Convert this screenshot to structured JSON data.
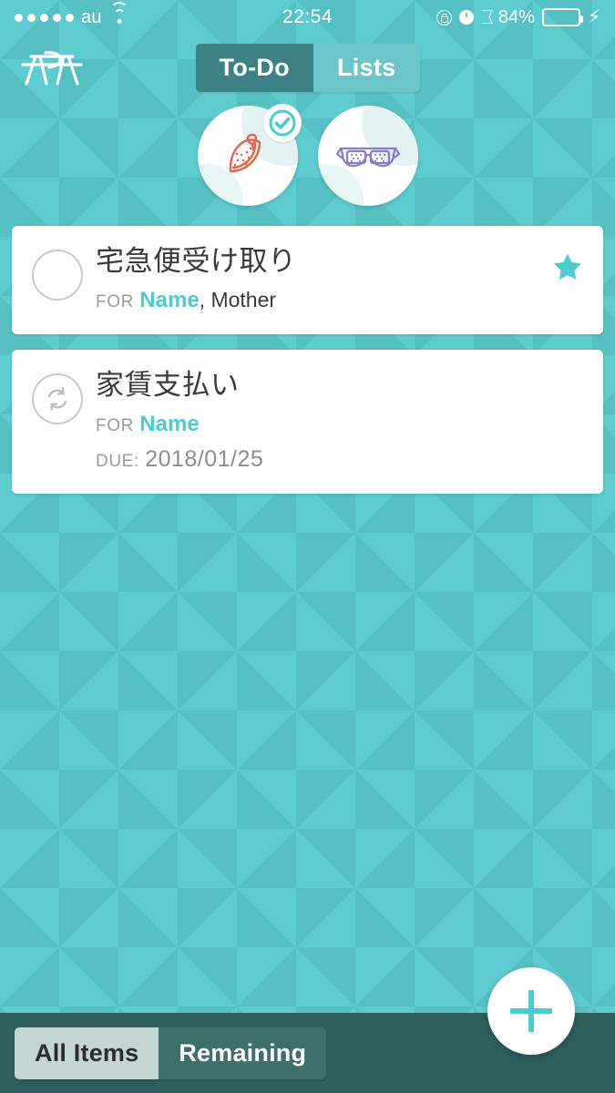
{
  "status_bar": {
    "signal_dots": 5,
    "carrier": "au",
    "wifi_icon": "wifi-icon",
    "time": "22:54",
    "rotation_lock_icon": "rotation-lock-icon",
    "alarm_icon": "alarm-clock-icon",
    "bluetooth_icon": "bluetooth-icon",
    "battery_percent": "84%",
    "battery_level": 84,
    "charging_icon": "lightning-bolt-icon",
    "battery_color": "#7ED957"
  },
  "header": {
    "logo_icon": "picnic-table-logo-icon",
    "tabs": [
      {
        "label": "To-Do",
        "active": true
      },
      {
        "label": "Lists",
        "active": false
      }
    ]
  },
  "avatars": [
    {
      "icon": "watermelon-slice-icon",
      "color": "#E2664A",
      "selected": true,
      "badge_icon": "check-circle-icon"
    },
    {
      "icon": "eyeglasses-icon",
      "color": "#8B7CC8",
      "selected": false
    }
  ],
  "tasks": [
    {
      "state_icon": "empty-circle-icon",
      "title": "宅急便受け取り",
      "for_label": "FOR",
      "for_name": "Name",
      "for_extra": ", Mother",
      "due_label": "",
      "due_value": "",
      "starred": true,
      "star_icon": "star-filled-icon"
    },
    {
      "state_icon": "repeat-circle-icon",
      "title": "家賃支払い",
      "for_label": "FOR",
      "for_name": "Name",
      "for_extra": "",
      "due_label": "DUE:",
      "due_value": "2018/01/25",
      "starred": false,
      "star_icon": ""
    }
  ],
  "bottom_bar": {
    "filters": [
      {
        "label": "All Items",
        "style": "light"
      },
      {
        "label": "Remaining",
        "style": "dark"
      }
    ],
    "add_button_icon": "plus-icon"
  },
  "colors": {
    "bg_light": "#5ECBCE",
    "bg_dark": "#56BFC2",
    "accent_teal": "#4ECBD0",
    "tab_active": "#3C8183",
    "tab_inactive": "#6CC6C8",
    "bottom_bar": "#2E5F5E",
    "card_bg": "#FFFFFF"
  }
}
